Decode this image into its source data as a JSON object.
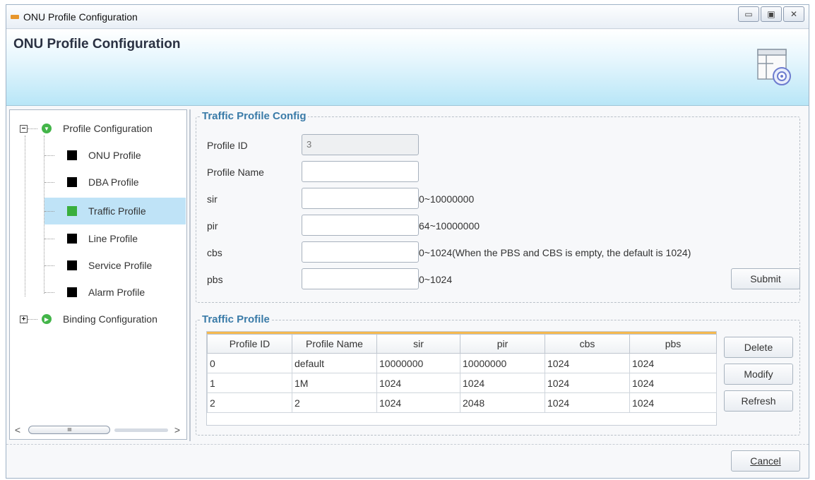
{
  "window": {
    "title": "ONU Profile Configuration",
    "minimize": "▭",
    "maximize": "▣",
    "close": "✕"
  },
  "banner": {
    "title": "ONU Profile Configuration",
    "icon": "config-dial-icon"
  },
  "tree": {
    "root1": {
      "label": "Profile Configuration",
      "expander": "−"
    },
    "items": [
      {
        "label": "ONU Profile",
        "selected": false
      },
      {
        "label": "DBA Profile",
        "selected": false
      },
      {
        "label": "Traffic Profile",
        "selected": true
      },
      {
        "label": "Line Profile",
        "selected": false
      },
      {
        "label": "Service Profile",
        "selected": false
      },
      {
        "label": "Alarm Profile",
        "selected": false
      }
    ],
    "root2": {
      "label": "Binding Configuration",
      "expander": "+"
    },
    "scroll_left": "<",
    "scroll_right": ">",
    "scroll_grip": "IIIIII"
  },
  "config": {
    "title": "Traffic Profile Config",
    "profile_id_label": "Profile ID",
    "profile_id_value": "3",
    "profile_name_label": "Profile Name",
    "profile_name_value": "",
    "sir_label": "sir",
    "sir_value": "",
    "sir_hint": "0~10000000",
    "pir_label": "pir",
    "pir_value": "",
    "pir_hint": "64~10000000",
    "cbs_label": "cbs",
    "cbs_value": "",
    "cbs_hint": "0~1024(When the PBS and CBS is empty, the default is 1024)",
    "pbs_label": "pbs",
    "pbs_value": "",
    "pbs_hint": "0~1024",
    "submit": "Submit"
  },
  "table": {
    "title": "Traffic Profile",
    "headers": [
      "Profile ID",
      "Profile Name",
      "sir",
      "pir",
      "cbs",
      "pbs"
    ],
    "rows": [
      [
        "0",
        "default",
        "10000000",
        "10000000",
        "1024",
        "1024"
      ],
      [
        "1",
        "1M",
        "1024",
        "1024",
        "1024",
        "1024"
      ],
      [
        "2",
        "2",
        "1024",
        "2048",
        "1024",
        "1024"
      ]
    ],
    "delete": "Delete",
    "modify": "Modify",
    "refresh": "Refresh"
  },
  "footer": {
    "cancel": "Cancel"
  },
  "colors": {
    "group_title": "#3a7ba8",
    "selection": "#bfe3f7",
    "status_green": "#43b549"
  }
}
